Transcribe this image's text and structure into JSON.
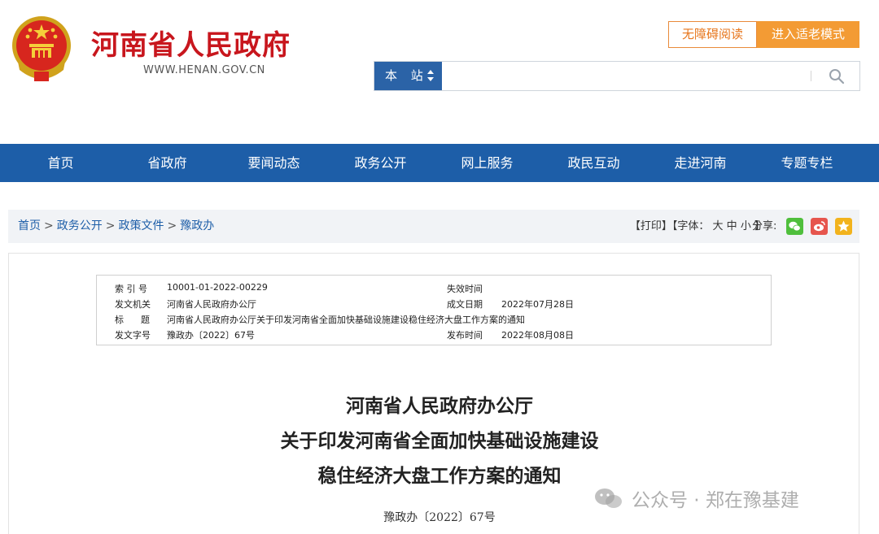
{
  "header": {
    "site_name": "河南省人民政府",
    "site_url": "WWW.HENAN.GOV.CN",
    "accessibility_label": "无障碍阅读",
    "elder_mode_label": "进入适老模式"
  },
  "search": {
    "scope": "本 站",
    "placeholder": ""
  },
  "nav": {
    "items": [
      "首页",
      "省政府",
      "要闻动态",
      "政务公开",
      "网上服务",
      "政民互动",
      "走进河南",
      "专题专栏"
    ]
  },
  "breadcrumb": {
    "items": [
      "首页",
      "政务公开",
      "政策文件",
      "豫政办"
    ],
    "separator": ">"
  },
  "tools": {
    "print": "【打印】",
    "font_label": "【字体：",
    "font_large": "大",
    "font_medium": "中",
    "font_small": "小",
    "font_end": "】",
    "share_label": "分享:"
  },
  "meta": {
    "index_label": "索 引 号",
    "index_value": "10001-01-2022-00229",
    "expire_label": "失效时间",
    "expire_value": "",
    "issuer_label": "发文机关",
    "issuer_value": "河南省人民政府办公厅",
    "created_label": "成文日期",
    "created_value": "2022年07月28日",
    "title_label": "标      题",
    "title_value": "河南省人民政府办公厅关于印发河南省全面加快基础设施建设稳住经济大盘工作方案的通知",
    "docno_label": "发文字号",
    "docno_value": "豫政办〔2022〕67号",
    "published_label": "发布时间",
    "published_value": "2022年08月08日"
  },
  "document": {
    "title_line1": "河南省人民政府办公厅",
    "title_line2": "关于印发河南省全面加快基础设施建设",
    "title_line3": "稳住经济大盘工作方案的通知",
    "number": "豫政办〔2022〕67号"
  },
  "watermark": {
    "text": "公众号 · 郑在豫基建"
  },
  "colors": {
    "brand_red": "#c8161d",
    "nav_blue": "#1d5ea8",
    "accent_orange": "#f39b34"
  }
}
